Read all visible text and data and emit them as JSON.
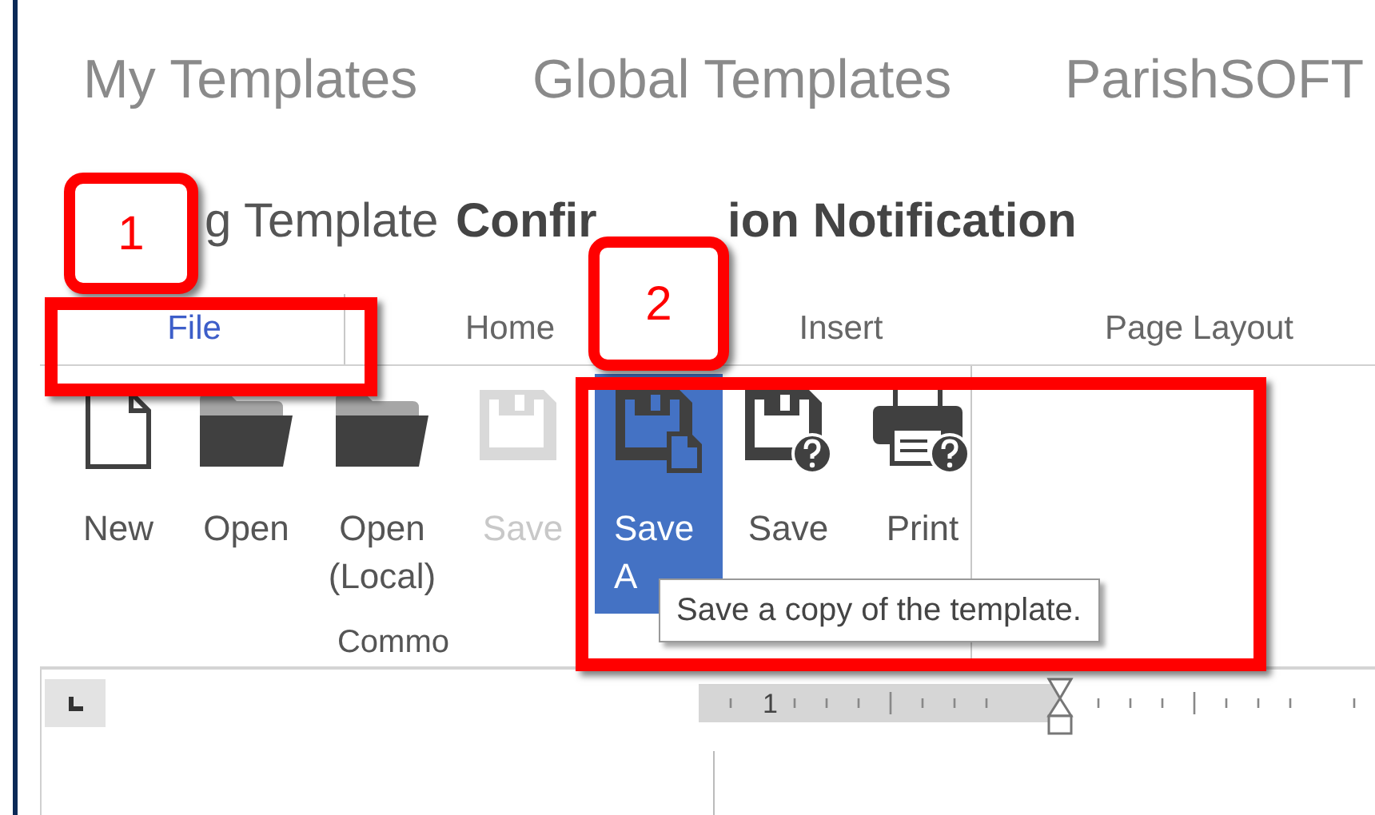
{
  "top_nav": [
    {
      "label": "My Templates"
    },
    {
      "label": "Global Templates"
    },
    {
      "label": "ParishSOFT"
    }
  ],
  "heading": {
    "prefix": "g Template",
    "bold_start": "Confir",
    "bold_end": "ion Notification"
  },
  "ribbon_tabs": [
    {
      "label": "File",
      "selected": true
    },
    {
      "label": "Home",
      "selected": false
    },
    {
      "label": "Insert",
      "selected": false
    },
    {
      "label": "Page Layout",
      "selected": false
    }
  ],
  "ribbon_buttons": [
    {
      "kind": "new",
      "lines": [
        "New"
      ],
      "disabled": false,
      "selected": false
    },
    {
      "kind": "open",
      "lines": [
        "Open"
      ],
      "disabled": false,
      "selected": false
    },
    {
      "kind": "open",
      "lines": [
        "Open",
        "(Local)"
      ],
      "disabled": false,
      "selected": false
    },
    {
      "kind": "save",
      "lines": [
        "Save"
      ],
      "disabled": true,
      "selected": false
    },
    {
      "kind": "save_as",
      "lines": [
        "Save",
        "A"
      ],
      "disabled": false,
      "selected": true
    },
    {
      "kind": "save_help",
      "lines": [
        "Save"
      ],
      "disabled": false,
      "selected": false
    },
    {
      "kind": "print_help",
      "lines": [
        "Print"
      ],
      "disabled": false,
      "selected": false
    }
  ],
  "group_label": "Commo",
  "tooltip": "Save a copy of the template.",
  "callouts": [
    "1",
    "2"
  ],
  "ruler": {
    "label": "1"
  }
}
